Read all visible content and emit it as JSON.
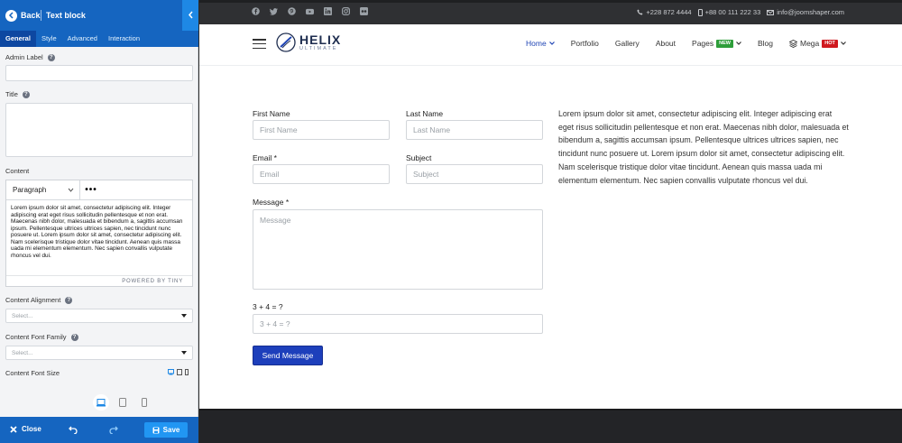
{
  "panel": {
    "back_label": "Back",
    "title": "Text block",
    "tabs": [
      "General",
      "Style",
      "Advanced",
      "Interaction"
    ],
    "active_tab": "General",
    "admin_label": "Admin Label",
    "title_label": "Title",
    "content_label": "Content",
    "paragraph_select": "Paragraph",
    "editor_text": "Lorem ipsum dolor sit amet, consectetur adipiscing elit. Integer adipiscing erat eget risus sollicitudin pellentesque et non erat. Maecenas nibh dolor, malesuada et bibendum a, sagittis accumsan ipsum. Pellentesque ultrices ultrices sapien, nec tincidunt nunc posuere ut. Lorem ipsum dolor sit amet, consectetur adipiscing elit. Nam scelerisque tristique dolor vitae tincidunt. Aenean quis massa uada mi elementum elementum. Nec sapien convallis vulputate rhoncus vel dui.",
    "powered_by": "POWERED BY TINY",
    "alignment_label": "Content Alignment",
    "alignment_placeholder": "Select...",
    "font_family_label": "Content Font Family",
    "font_family_placeholder": "Select...",
    "font_size_label": "Content Font Size",
    "close_label": "Close",
    "save_label": "Save"
  },
  "site": {
    "contact": {
      "phone1": "+228 872 4444",
      "phone2": "+88 00 111 222 33",
      "email": "info@joomshaper.com"
    },
    "logo": {
      "main": "HELIX",
      "sub": "ULTIMATE"
    },
    "menu": [
      {
        "label": "Home",
        "active": true,
        "dropdown": true
      },
      {
        "label": "Portfolio"
      },
      {
        "label": "Gallery"
      },
      {
        "label": "About"
      },
      {
        "label": "Pages",
        "badge": "NEW",
        "dropdown": true
      },
      {
        "label": "Blog"
      },
      {
        "label": "Mega",
        "badge": "HOT",
        "dropdown": true
      }
    ],
    "form": {
      "first_name_label": "First Name",
      "first_name_placeholder": "First Name",
      "last_name_label": "Last Name",
      "last_name_placeholder": "Last Name",
      "email_label": "Email *",
      "email_placeholder": "Email",
      "subject_label": "Subject",
      "subject_placeholder": "Subject",
      "message_label": "Message *",
      "message_placeholder": "Message",
      "captcha_label": "3 + 4 = ?",
      "captcha_placeholder": "3 + 4 = ?",
      "send_label": "Send Message"
    },
    "body_text": "Lorem ipsum dolor sit amet, consectetur adipiscing elit. Integer adipiscing erat eget risus sollicitudin pellentesque et non erat. Maecenas nibh dolor, malesuada et bibendum a, sagittis accumsan ipsum. Pellentesque ultrices ultrices sapien, nec tincidunt nunc posuere ut. Lorem ipsum dolor sit amet, consectetur adipiscing elit. Nam scelerisque tristique dolor vitae tincidunt. Aenean quis massa uada mi elementum elementum. Nec sapien convallis vulputate rhoncus vel dui."
  },
  "colors": {
    "panel_blue": "#1565c0",
    "site_accent": "#1d3fbb",
    "badge_new": "#2e9e3a",
    "badge_hot": "#d0191f"
  },
  "icons": [
    "back-arrow-icon",
    "collapse-chevron-icon",
    "help-icon",
    "desktop-icon",
    "tablet-icon",
    "mobile-icon",
    "close-icon",
    "undo-icon",
    "redo-icon",
    "save-icon",
    "facebook-icon",
    "twitter-icon",
    "pinterest-icon",
    "youtube-icon",
    "linkedin-icon",
    "instagram-icon",
    "flickr-icon",
    "phone-icon",
    "mobile-phone-icon",
    "mail-icon",
    "hamburger-icon",
    "mega-menu-icon"
  ]
}
